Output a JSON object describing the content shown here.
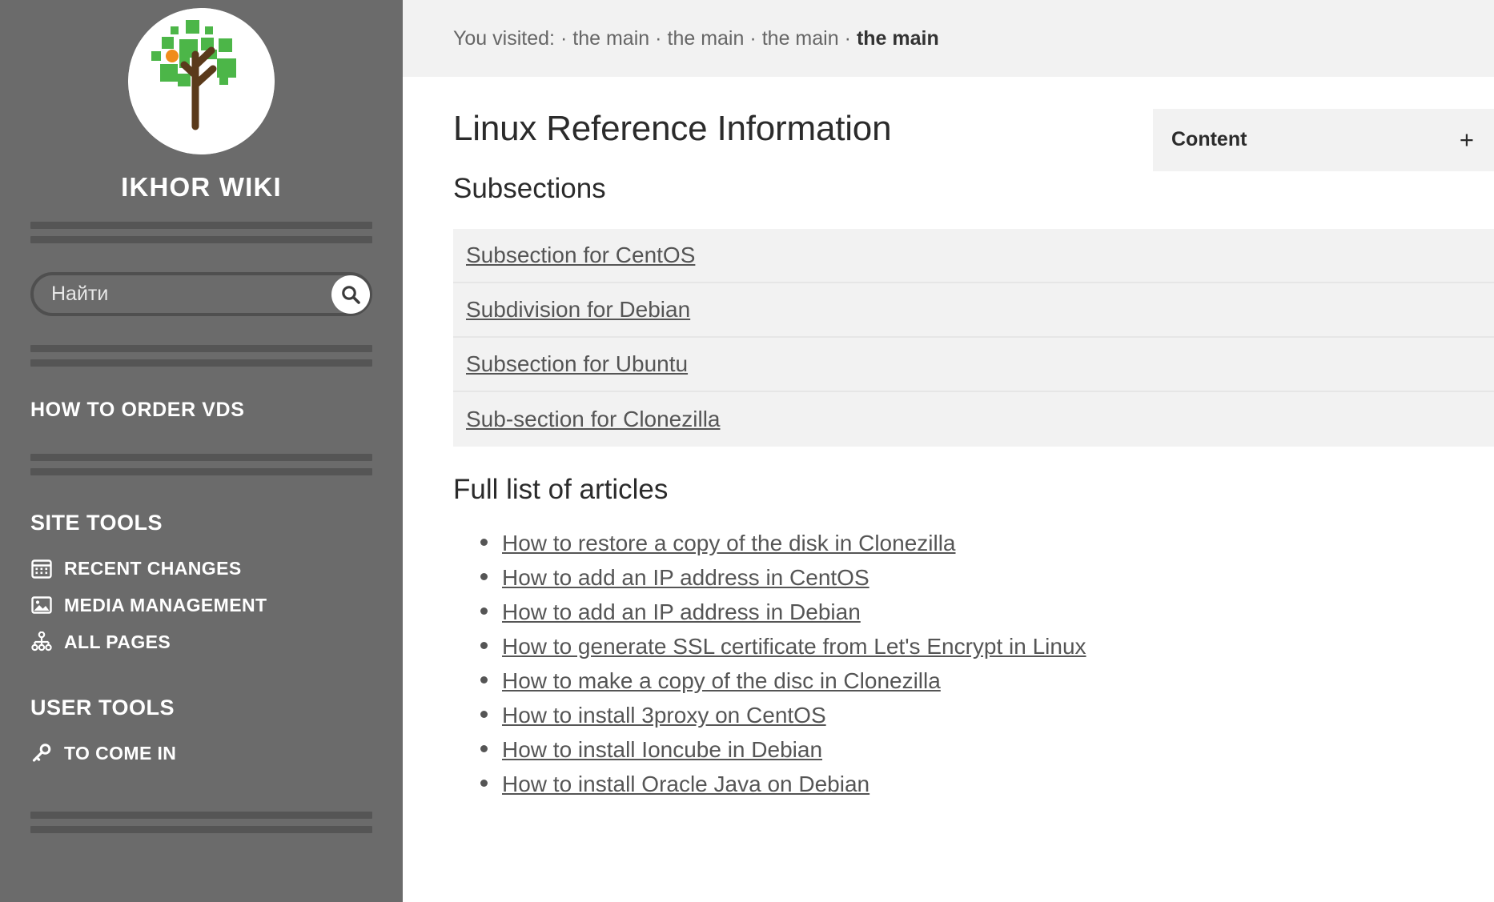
{
  "sidebar": {
    "logo_alt": "tree-logo",
    "site_title": "IKHOR WIKI",
    "search": {
      "placeholder": "Найти",
      "value": ""
    },
    "order_link": "HOW TO ORDER VDS",
    "site_tools": {
      "heading": "SITE TOOLS",
      "items": [
        {
          "label": "RECENT CHANGES",
          "icon": "calendar-icon"
        },
        {
          "label": "MEDIA MANAGEMENT",
          "icon": "image-icon"
        },
        {
          "label": "ALL PAGES",
          "icon": "sitemap-icon"
        }
      ]
    },
    "user_tools": {
      "heading": "USER TOOLS",
      "items": [
        {
          "label": "TO COME IN",
          "icon": "key-icon"
        }
      ]
    }
  },
  "breadcrumb": {
    "prefix": "You visited:",
    "separator": "·",
    "items": [
      "the main",
      "the main",
      "the main"
    ],
    "current": "the main"
  },
  "main": {
    "page_title": "Linux Reference Information",
    "subsections_heading": "Subsections",
    "subsections": [
      "Subsection for CentOS",
      "Subdivision for Debian",
      "Subsection for Ubuntu",
      "Sub-section for Clonezilla"
    ],
    "articles_heading": "Full list of articles",
    "articles": [
      "How to restore a copy of the disk in Clonezilla",
      "How to add an IP address in CentOS",
      "How to add an IP address in Debian",
      "How to generate SSL certificate from Let's Encrypt in Linux",
      "How to make a copy of the disc in Clonezilla",
      "How to install 3proxy on CentOS",
      "How to install Ioncube in Debian",
      "How to install Oracle Java on Debian"
    ]
  },
  "toc": {
    "title": "Content",
    "toggle": "+"
  },
  "colors": {
    "sidebar_bg": "#6b6b6b",
    "divider": "#555555",
    "panel_bg": "#f2f2f2",
    "link": "#555555",
    "logo_green": "#4cb648",
    "logo_orange": "#f08c1b",
    "logo_brown": "#5a3a1b"
  }
}
